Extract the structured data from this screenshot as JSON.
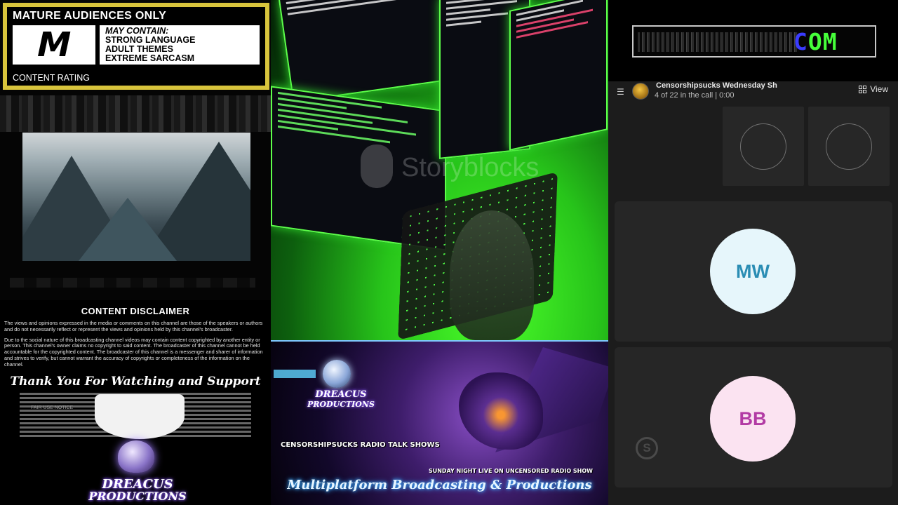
{
  "rating": {
    "title": "MATURE AUDIENCES ONLY",
    "letter": "M",
    "may_contain": "MAY CONTAIN:",
    "items": [
      "STRONG LANGUAGE",
      "ADULT THEMES",
      "EXTREME SARCASM"
    ],
    "footer": "CONTENT RATING",
    "border_color": "#d8c43c"
  },
  "disclaimer": {
    "title": "CONTENT DISCLAIMER",
    "para1": "The views and opinions expressed in the media or comments on this channel are those of the speakers or authors and do not necessarily reflect or represent the views and opinions held by this channel's broadcaster.",
    "para2": "Due to the social nature of this broadcasting channel videos may contain content copyrighted by another entity or person. This channel's owner claims no copyright to said content. The broadcaster of this channel cannot be held accountable for the copyrighted content. The broadcaster of this channel is a messenger and sharer of information and strives to verify, but cannot warrant the accuracy of copyrights or completeness of the information on the channel.",
    "thanks": "Thank You For Watching and Support",
    "fair_use": "FAIR USE NOTICE"
  },
  "branding": {
    "logo_line1": "DREACUS",
    "logo_line2": "PRODUCTIONS"
  },
  "hacker_panel": {
    "watermark": "Storyblocks",
    "accent_color": "#4cff2a"
  },
  "dragon_panel": {
    "show_title": "CENSORSHIPSUCKS RADIO TALK SHOWS",
    "show_subtitle": "SUNDAY NIGHT LIVE ON UNCENSORED RADIO SHOW",
    "tagline": "Multiplatform Broadcasting & Productions"
  },
  "ticker": {
    "text": "COM"
  },
  "call": {
    "name": "Censorshipsucks Wednesday Sh",
    "status": "4 of 22 in the call | 0:00",
    "view_label": "View",
    "participants": [
      {
        "initials": "MW",
        "bg": "#e6f6fb",
        "fg": "#2a8db4"
      },
      {
        "initials": "BB",
        "bg": "#fbe3f1",
        "fg": "#b23aa4"
      }
    ]
  }
}
